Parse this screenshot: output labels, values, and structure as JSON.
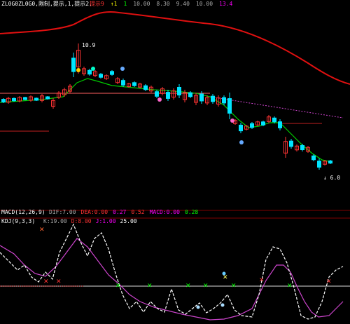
{
  "top_header": {
    "title": "ZL0G0ZL0G0,限制,提示,1,提示2,",
    "items": [
      {
        "label": "提示",
        "value": "9",
        "color": "#ff3333"
      },
      {
        "label": "",
        "value": "↑1",
        "color": "#ffff00"
      },
      {
        "label": "",
        "value": "1",
        "color": "#00ff00"
      },
      {
        "label": "",
        "value": "10.00",
        "color": "#aaaaaa"
      },
      {
        "label": "",
        "value": "8.30",
        "color": "#aaaaaa"
      },
      {
        "label": "",
        "value": "9.40",
        "color": "#aaaaaa"
      },
      {
        "label": "",
        "value": "10.00",
        "color": "#aaaaaa"
      },
      {
        "label": "",
        "value": "13.4",
        "color": "#ff00ff"
      }
    ]
  },
  "price_panel": {
    "high_label": "10.9",
    "low_label": "↓ 6.0",
    "colors": {
      "up": "#ff3333",
      "down": "#00e5ff",
      "ma_green": "#00cc00",
      "ma_red": "#e01010",
      "hline": "#ff6060",
      "purple": "#cc44cc"
    }
  },
  "indicator_header": {
    "name": "MACD(12,26,9)",
    "items": [
      {
        "label": "DIF:",
        "value": "7.00",
        "color": "#aaaaaa"
      },
      {
        "label": "DEA:",
        "value": "0.00",
        "color": "#ff3333"
      },
      {
        "label": "",
        "value": "0.27",
        "color": "#ff00ff"
      },
      {
        "label": "",
        "value": "0.52",
        "color": "#ff3333"
      },
      {
        "label": "MACD:",
        "value": "0.00",
        "color": "#ff00ff"
      },
      {
        "label": "",
        "value": "0.28",
        "color": "#00ff00"
      }
    ]
  },
  "kdj_header": {
    "name": "KDJ(9,3,3)",
    "items": [
      {
        "label": "K:",
        "value": "19.00",
        "color": "#aaaaaa"
      },
      {
        "label": "D:",
        "value": "8.00",
        "color": "#ff3333"
      },
      {
        "label": "J:",
        "value": "1.00",
        "color": "#ff00ff"
      },
      {
        "label": "",
        "value": "25.00",
        "color": "#ffffff"
      }
    ]
  }
}
